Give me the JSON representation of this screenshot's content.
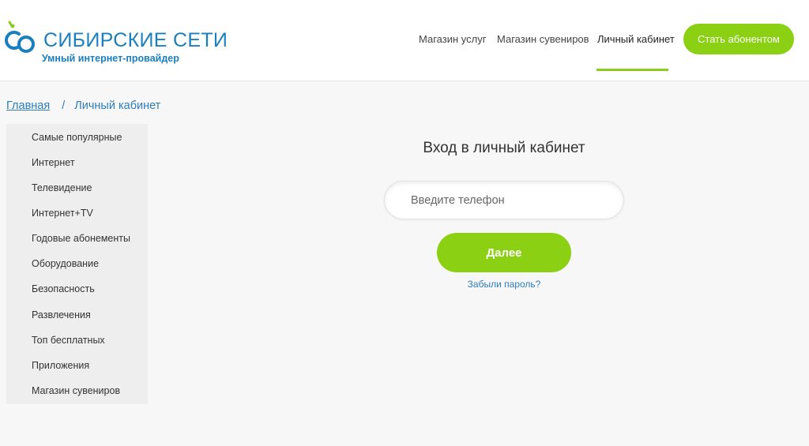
{
  "brand": {
    "name": "СИБИРСКИЕ СЕТИ",
    "tagline": "Умный интернет-провайдер",
    "primary_color": "#1a7fc0",
    "accent_color": "#8bd012"
  },
  "nav": {
    "items": [
      {
        "label": "Магазин услуг"
      },
      {
        "label": "Магазин сувениров"
      },
      {
        "label": "Личный кабинет",
        "active": true
      }
    ],
    "cta_label": "Стать абонентом"
  },
  "breadcrumb": {
    "home": "Главная",
    "separator": "/",
    "current": "Личный кабинет"
  },
  "sidebar": {
    "items": [
      {
        "label": "Самые популярные"
      },
      {
        "label": "Интернет"
      },
      {
        "label": "Телевидение"
      },
      {
        "label": "Интернет+TV"
      },
      {
        "label": "Годовые абонементы"
      },
      {
        "label": "Оборудование"
      },
      {
        "label": "Безопасность"
      },
      {
        "label": "Развлечения"
      },
      {
        "label": "Топ бесплатных"
      },
      {
        "label": "Приложения"
      },
      {
        "label": "Магазин сувениров"
      }
    ]
  },
  "login": {
    "title": "Вход в личный кабинет",
    "phone_placeholder": "Введите телефон",
    "phone_value": "",
    "submit_label": "Далее",
    "forgot_label": "Забыли пароль?"
  }
}
